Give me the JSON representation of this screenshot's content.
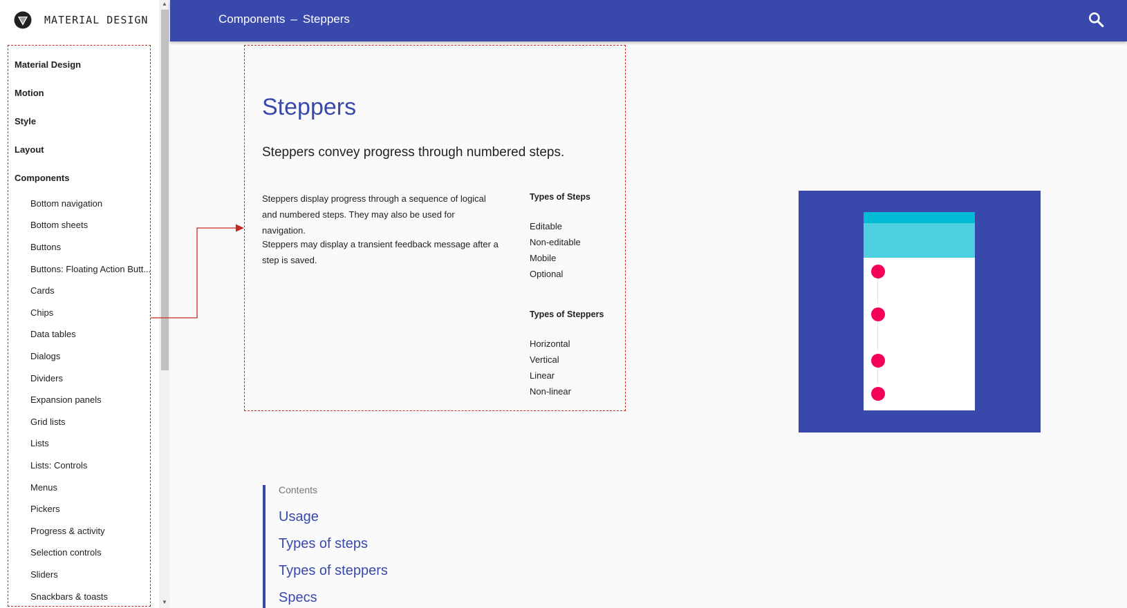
{
  "brand": {
    "title": "MATERIAL DESIGN"
  },
  "header": {
    "section": "Components",
    "separator": "–",
    "page": "Steppers"
  },
  "sidebar": {
    "top_items": [
      "Material Design",
      "Motion",
      "Style",
      "Layout",
      "Components"
    ],
    "sub_items": [
      "Bottom navigation",
      "Bottom sheets",
      "Buttons",
      "Buttons: Floating Action Butt...",
      "Cards",
      "Chips",
      "Data tables",
      "Dialogs",
      "Dividers",
      "Expansion panels",
      "Grid lists",
      "Lists",
      "Lists: Controls",
      "Menus",
      "Pickers",
      "Progress & activity",
      "Selection controls",
      "Sliders",
      "Snackbars & toasts"
    ]
  },
  "main": {
    "title": "Steppers",
    "subtitle": "Steppers convey progress through numbered steps.",
    "para1": "Steppers display progress through a sequence of logical and numbered steps. They may also be used for navigation.",
    "para2": "Steppers may display a transient feedback message after a step is saved.",
    "types_steps_heading": "Types of Steps",
    "types_steps": [
      "Editable",
      "Non-editable",
      "Mobile",
      "Optional"
    ],
    "types_steppers_heading": "Types of Steppers",
    "types_steppers": [
      "Horizontal",
      "Vertical",
      "Linear",
      "Non-linear"
    ]
  },
  "contents": {
    "label": "Contents",
    "links": [
      "Usage",
      "Types of steps",
      "Types of steppers",
      "Specs"
    ]
  },
  "colors": {
    "primary": "#3949ab",
    "accent": "#f50057",
    "cyan": "#00bcd4",
    "cyan_light": "#4dd0e1",
    "annotation": "#c62828"
  },
  "icons": {
    "search": "search-icon",
    "logo": "material-logo-icon"
  }
}
